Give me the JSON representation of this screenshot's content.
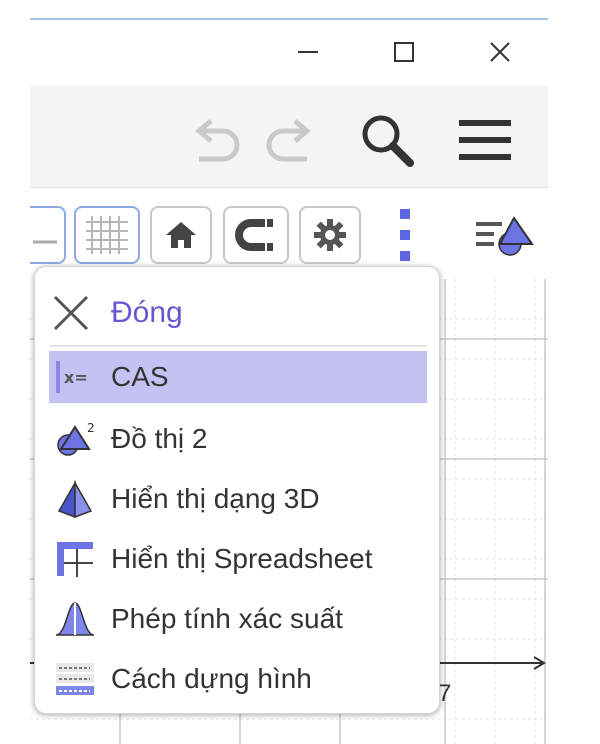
{
  "window": {
    "minimize_icon": "minimize-icon",
    "maximize_icon": "maximize-icon",
    "close_icon": "close-icon"
  },
  "toolbar": {
    "undo_icon": "undo-icon",
    "redo_icon": "redo-icon",
    "search_icon": "search-icon",
    "menu_icon": "hamburger-menu-icon"
  },
  "graphics_style_bar": {
    "buttons": [
      "axes-icon",
      "grid-icon",
      "home-icon",
      "magnet-icon",
      "gear-icon",
      "more-vertical-icon",
      "views-toggle-icon"
    ]
  },
  "graphics": {
    "axis_tick_label": "7"
  },
  "perspective_menu": {
    "close_label": "Đóng",
    "items": [
      {
        "label": "CAS",
        "icon": "cas-icon",
        "selected": true
      },
      {
        "label": "Đồ thị 2",
        "icon": "graphics-2-icon",
        "selected": false
      },
      {
        "label": "Hiển thị dạng 3D",
        "icon": "3d-view-icon",
        "selected": false
      },
      {
        "label": "Hiển thị Spreadsheet",
        "icon": "spreadsheet-icon",
        "selected": false
      },
      {
        "label": "Phép tính xác suất",
        "icon": "probability-icon",
        "selected": false
      },
      {
        "label": "Cách dựng hình",
        "icon": "construction-protocol-icon",
        "selected": false
      }
    ]
  },
  "colors": {
    "accent": "#6557d2",
    "selection": "#c4c2f3",
    "icon_blue": "#5a67e0"
  }
}
